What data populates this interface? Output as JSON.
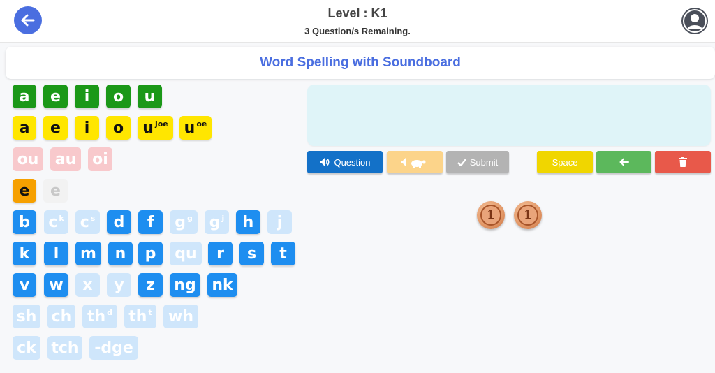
{
  "header": {
    "level_title": "Level : K1",
    "remaining": "3 Question/s Remaining.",
    "back_icon": "arrow-left-icon",
    "profile_icon": "user-avatar-icon"
  },
  "banner": {
    "title": "Word Spelling with Soundboard"
  },
  "tiles": {
    "short_vowels": [
      "a",
      "e",
      "i",
      "o",
      "u"
    ],
    "long_vowels": [
      "a",
      "e",
      "i",
      "o",
      "u",
      "u"
    ],
    "long_vowel_sups": {
      "u1": "joe",
      "u2": "oe"
    },
    "diphthongs": [
      "ou",
      "au",
      "oi"
    ],
    "schwa": [
      "e",
      "e"
    ],
    "row_consonants_1": [
      "b",
      "c",
      "c",
      "d",
      "f",
      "g",
      "g",
      "h",
      "j"
    ],
    "row_consonants_1_sups": {
      "c1": "k",
      "c2": "s",
      "g1": "g",
      "g2": "j"
    },
    "row_consonants_2": [
      "k",
      "l",
      "m",
      "n",
      "p",
      "qu",
      "r",
      "s",
      "t"
    ],
    "row_consonants_3": [
      "v",
      "w",
      "x",
      "y",
      "z",
      "ng",
      "nk"
    ],
    "digraphs": [
      "sh",
      "ch",
      "th",
      "th",
      "wh"
    ],
    "digraph_sups": {
      "th1": "d",
      "th2": "t"
    },
    "endings": [
      "ck",
      "tch",
      "-dge"
    ]
  },
  "controls": {
    "question": "Question",
    "audio_slow_icon": "speaker-turtle-icon",
    "submit": "Submit",
    "space": "Space",
    "backspace_icon": "arrow-left-icon",
    "delete_icon": "trash-icon"
  },
  "coins": {
    "count": 2,
    "label": "1"
  },
  "colors": {
    "accent": "#4a6ee0",
    "green": "#1b9818",
    "yellow": "#ffe600",
    "blue": "#1e8ef0",
    "orange": "#f6a000",
    "question_btn": "#1371c8",
    "backspace_btn": "#5cb85c",
    "delete_btn": "#e8594a"
  }
}
